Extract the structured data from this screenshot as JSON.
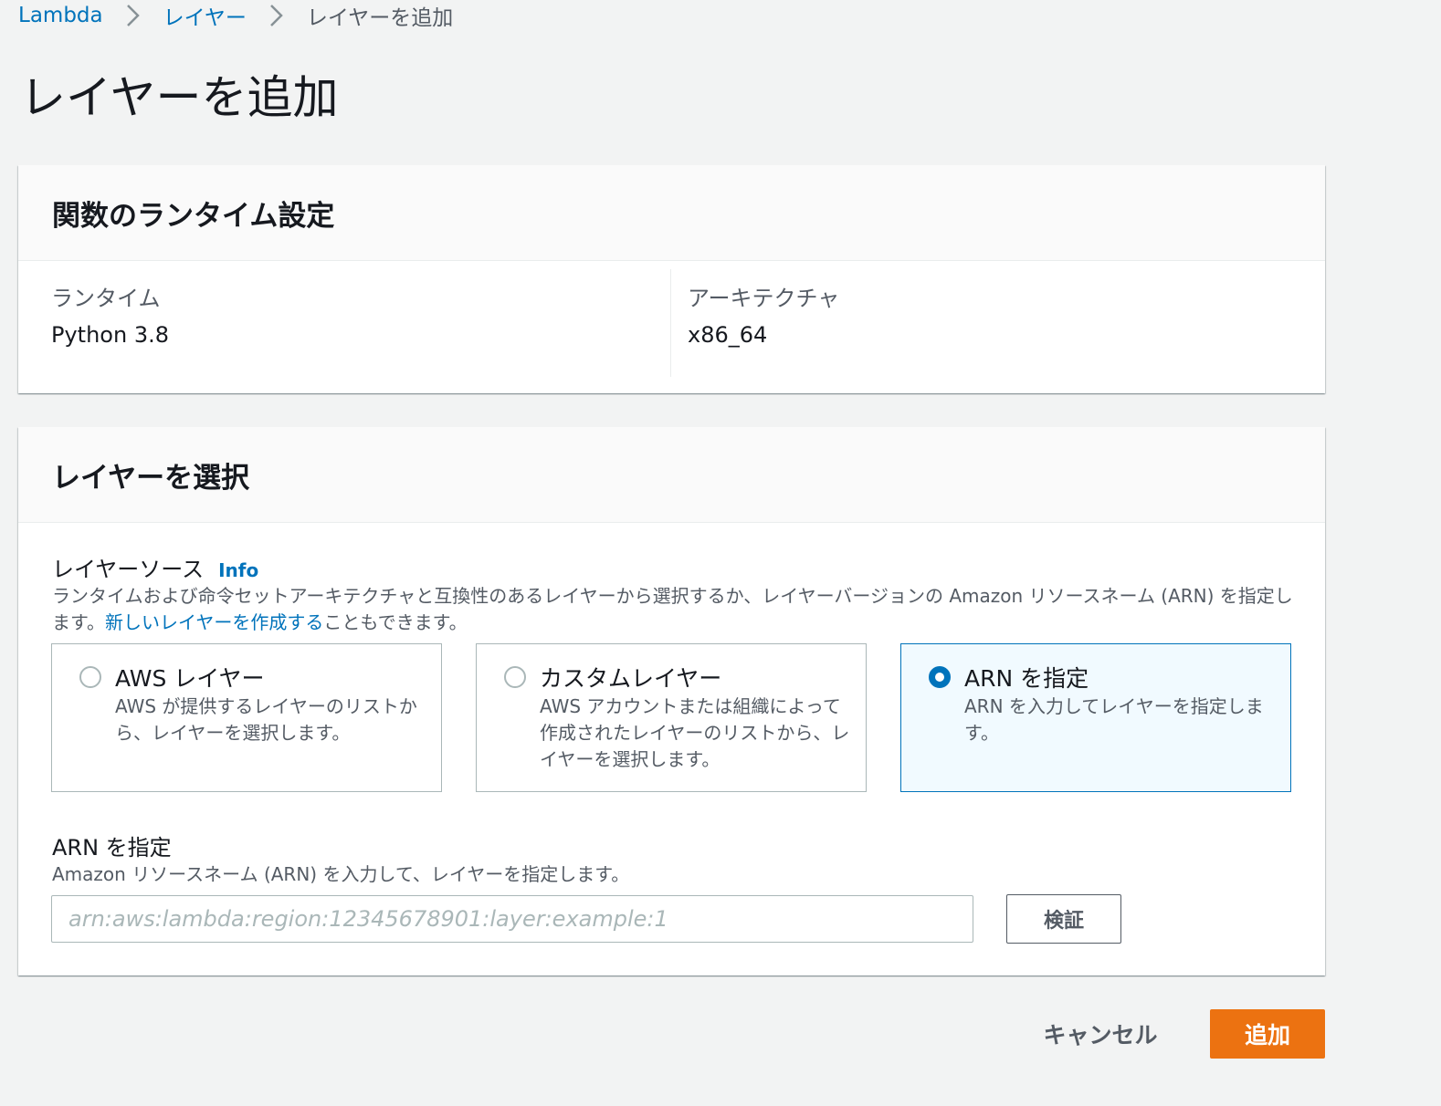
{
  "breadcrumb": {
    "items": [
      "Lambda",
      "レイヤー",
      "レイヤーを追加"
    ]
  },
  "page_title": "レイヤーを追加",
  "runtime_settings": {
    "title": "関数のランタイム設定",
    "runtime_label": "ランタイム",
    "runtime_value": "Python 3.8",
    "architecture_label": "アーキテクチャ",
    "architecture_value": "x86_64"
  },
  "choose_layer": {
    "title": "レイヤーを選択",
    "source_label": "レイヤーソース",
    "info_link": "Info",
    "source_desc_before": "ランタイムおよび命令セットアーキテクチャと互換性のあるレイヤーから選択するか、レイヤーバージョンの Amazon リソースネーム (ARN) を指定します。",
    "source_desc_link": "新しいレイヤーを作成する",
    "source_desc_after": "こともできます。",
    "options": [
      {
        "title": "AWS レイヤー",
        "desc": "AWS が提供するレイヤーのリストから、レイヤーを選択します。",
        "selected": false
      },
      {
        "title": "カスタムレイヤー",
        "desc": "AWS アカウントまたは組織によって作成されたレイヤーのリストから、レイヤーを選択します。",
        "selected": false
      },
      {
        "title": "ARN を指定",
        "desc": "ARN を入力してレイヤーを指定します。",
        "selected": true
      }
    ],
    "arn_label": "ARN を指定",
    "arn_desc": "Amazon リソースネーム (ARN) を入力して、レイヤーを指定します。",
    "arn_placeholder": "arn:aws:lambda:region:12345678901:layer:example:1",
    "arn_value": "",
    "verify_button": "検証"
  },
  "footer": {
    "cancel_button": "キャンセル",
    "add_button": "追加"
  },
  "colors": {
    "link": "#0073bb",
    "primary": "#ec7211",
    "background": "#f2f3f3"
  }
}
